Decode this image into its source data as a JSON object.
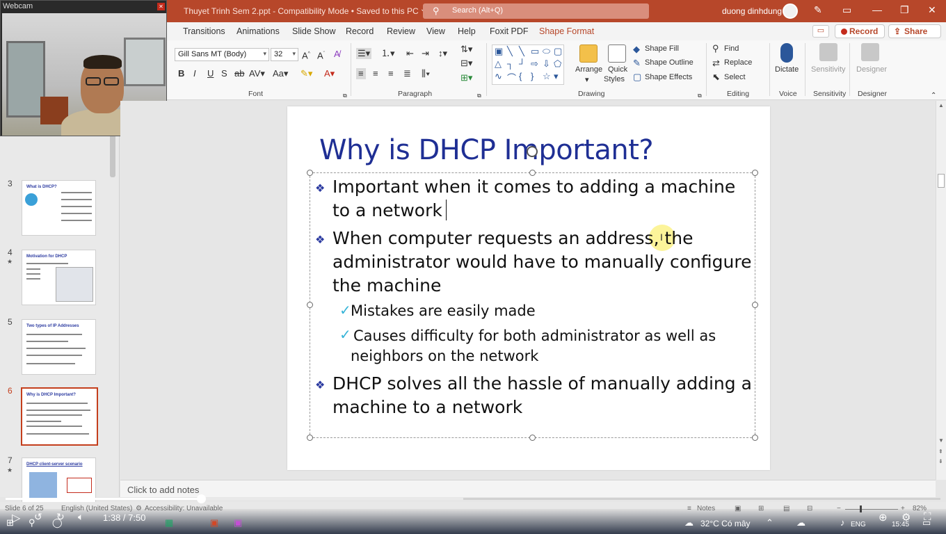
{
  "titlebar": {
    "doc_title": "Thuyet Trinh Sem 2.ppt  -  Compatibility Mode  •  Saved to this PC",
    "search_placeholder": "Search (Alt+Q)",
    "user_name": "duong dinhdung"
  },
  "tabs": [
    "Transitions",
    "Animations",
    "Slide Show",
    "Record",
    "Review",
    "View",
    "Help",
    "Foxit PDF",
    "Shape Format"
  ],
  "tab_actions": {
    "record": "Record",
    "share": "Share"
  },
  "ribbon": {
    "font_name": "Gill Sans MT (Body)",
    "font_size": "32",
    "groups": {
      "font": "Font",
      "paragraph": "Paragraph",
      "drawing": "Drawing",
      "editing": "Editing",
      "voice": "Voice",
      "sensitivity": "Sensitivity",
      "designer": "Designer"
    },
    "drawing": {
      "arrange": "Arrange",
      "quick_styles": [
        "Quick",
        "Styles"
      ],
      "shape_fill": "Shape Fill",
      "shape_outline": "Shape Outline",
      "shape_effects": "Shape Effects"
    },
    "editing": {
      "find": "Find",
      "replace": "Replace",
      "select": "Select"
    },
    "voice": {
      "dictate": "Dictate"
    },
    "sensitivity": {
      "label": "Sensitivity"
    },
    "designer": {
      "label": "Designer"
    }
  },
  "webcam": {
    "title": "Webcam"
  },
  "thumbnails": [
    {
      "num": "",
      "title": "",
      "star": false
    },
    {
      "num": "3",
      "title": "What is DHCP?",
      "star": false
    },
    {
      "num": "4",
      "title": "Motivation for DHCP",
      "star": true
    },
    {
      "num": "5",
      "title": "Two types of IP Addresses",
      "star": false
    },
    {
      "num": "6",
      "title": "Why is DHCP Important?",
      "star": false,
      "active": true
    },
    {
      "num": "7",
      "title": "DHCP client-server scenario",
      "star": true
    }
  ],
  "slide": {
    "title": "Why is DHCP Important?",
    "bullets": [
      {
        "level": 1,
        "lines": [
          "Important when it comes to adding a machine",
          "to a network"
        ]
      },
      {
        "level": 1,
        "lines": [
          "When computer requests an address, the",
          "administrator would have to manually configure",
          "the machine"
        ]
      },
      {
        "level": 2,
        "lines": [
          "Mistakes are easily made"
        ]
      },
      {
        "level": 2,
        "lines": [
          "Causes difficulty for both administrator as well as",
          "neighbors on the network"
        ]
      },
      {
        "level": 1,
        "lines": [
          "DHCP solves all the hassle of manually adding a",
          "machine to a network"
        ]
      }
    ]
  },
  "notes_placeholder": "Click to add notes",
  "statusbar": {
    "slide_info": "Slide 6 of 25",
    "language": "English (United States)",
    "accessibility": "Accessibility: Unavailable",
    "notes": "Notes",
    "zoom": "82%"
  },
  "video": {
    "current_time": "1:38",
    "duration": "7:50",
    "time_display": "1:38 / 7:50",
    "progress": 0.209
  },
  "taskbar": {
    "weather": "32°C  Có mây",
    "language": "ENG",
    "clock": "15:45"
  }
}
